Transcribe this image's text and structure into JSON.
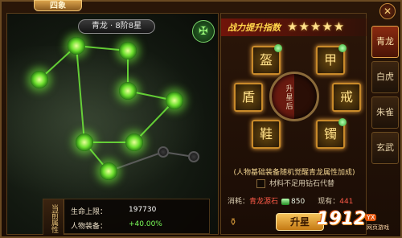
{
  "window": {
    "title": "四象",
    "close_glyph": "✕"
  },
  "constellation": {
    "level_label": "青龙 · 8阶8星",
    "emblem_glyph": "✠",
    "nodes_lit": 8,
    "nodes_total": 10
  },
  "stats": {
    "side_label": "当前属性",
    "hp_label": "生命上限：",
    "hp_value": "197730",
    "equip_label": "人物装备：",
    "equip_value": "+40.00%"
  },
  "upgrade": {
    "rating_label": "战力提升指数",
    "stars": "★★★★★",
    "center_label": "升星后",
    "desc": "(人物基础装备随机觉醒青龙属性加成)",
    "checkbox_label": "材料不足用钻石代替",
    "cost_label": "消耗：",
    "cost_item": "青龙源石",
    "cost_amount": "850",
    "have_label": "现有：",
    "have_amount": "441",
    "button_label": "升星"
  },
  "slots": [
    {
      "icon": "盔"
    },
    {
      "icon": "甲"
    },
    {
      "icon": "盾"
    },
    {
      "icon": "戒"
    },
    {
      "icon": "鞋"
    },
    {
      "icon": "镯"
    }
  ],
  "tabs": [
    {
      "label": "青龙",
      "active": true
    },
    {
      "label": "白虎",
      "active": false
    },
    {
      "label": "朱雀",
      "active": false
    },
    {
      "label": "玄武",
      "active": false
    }
  ],
  "watermark": {
    "brand": "1912",
    "badge": "YX",
    "sub": "网页游戏"
  }
}
